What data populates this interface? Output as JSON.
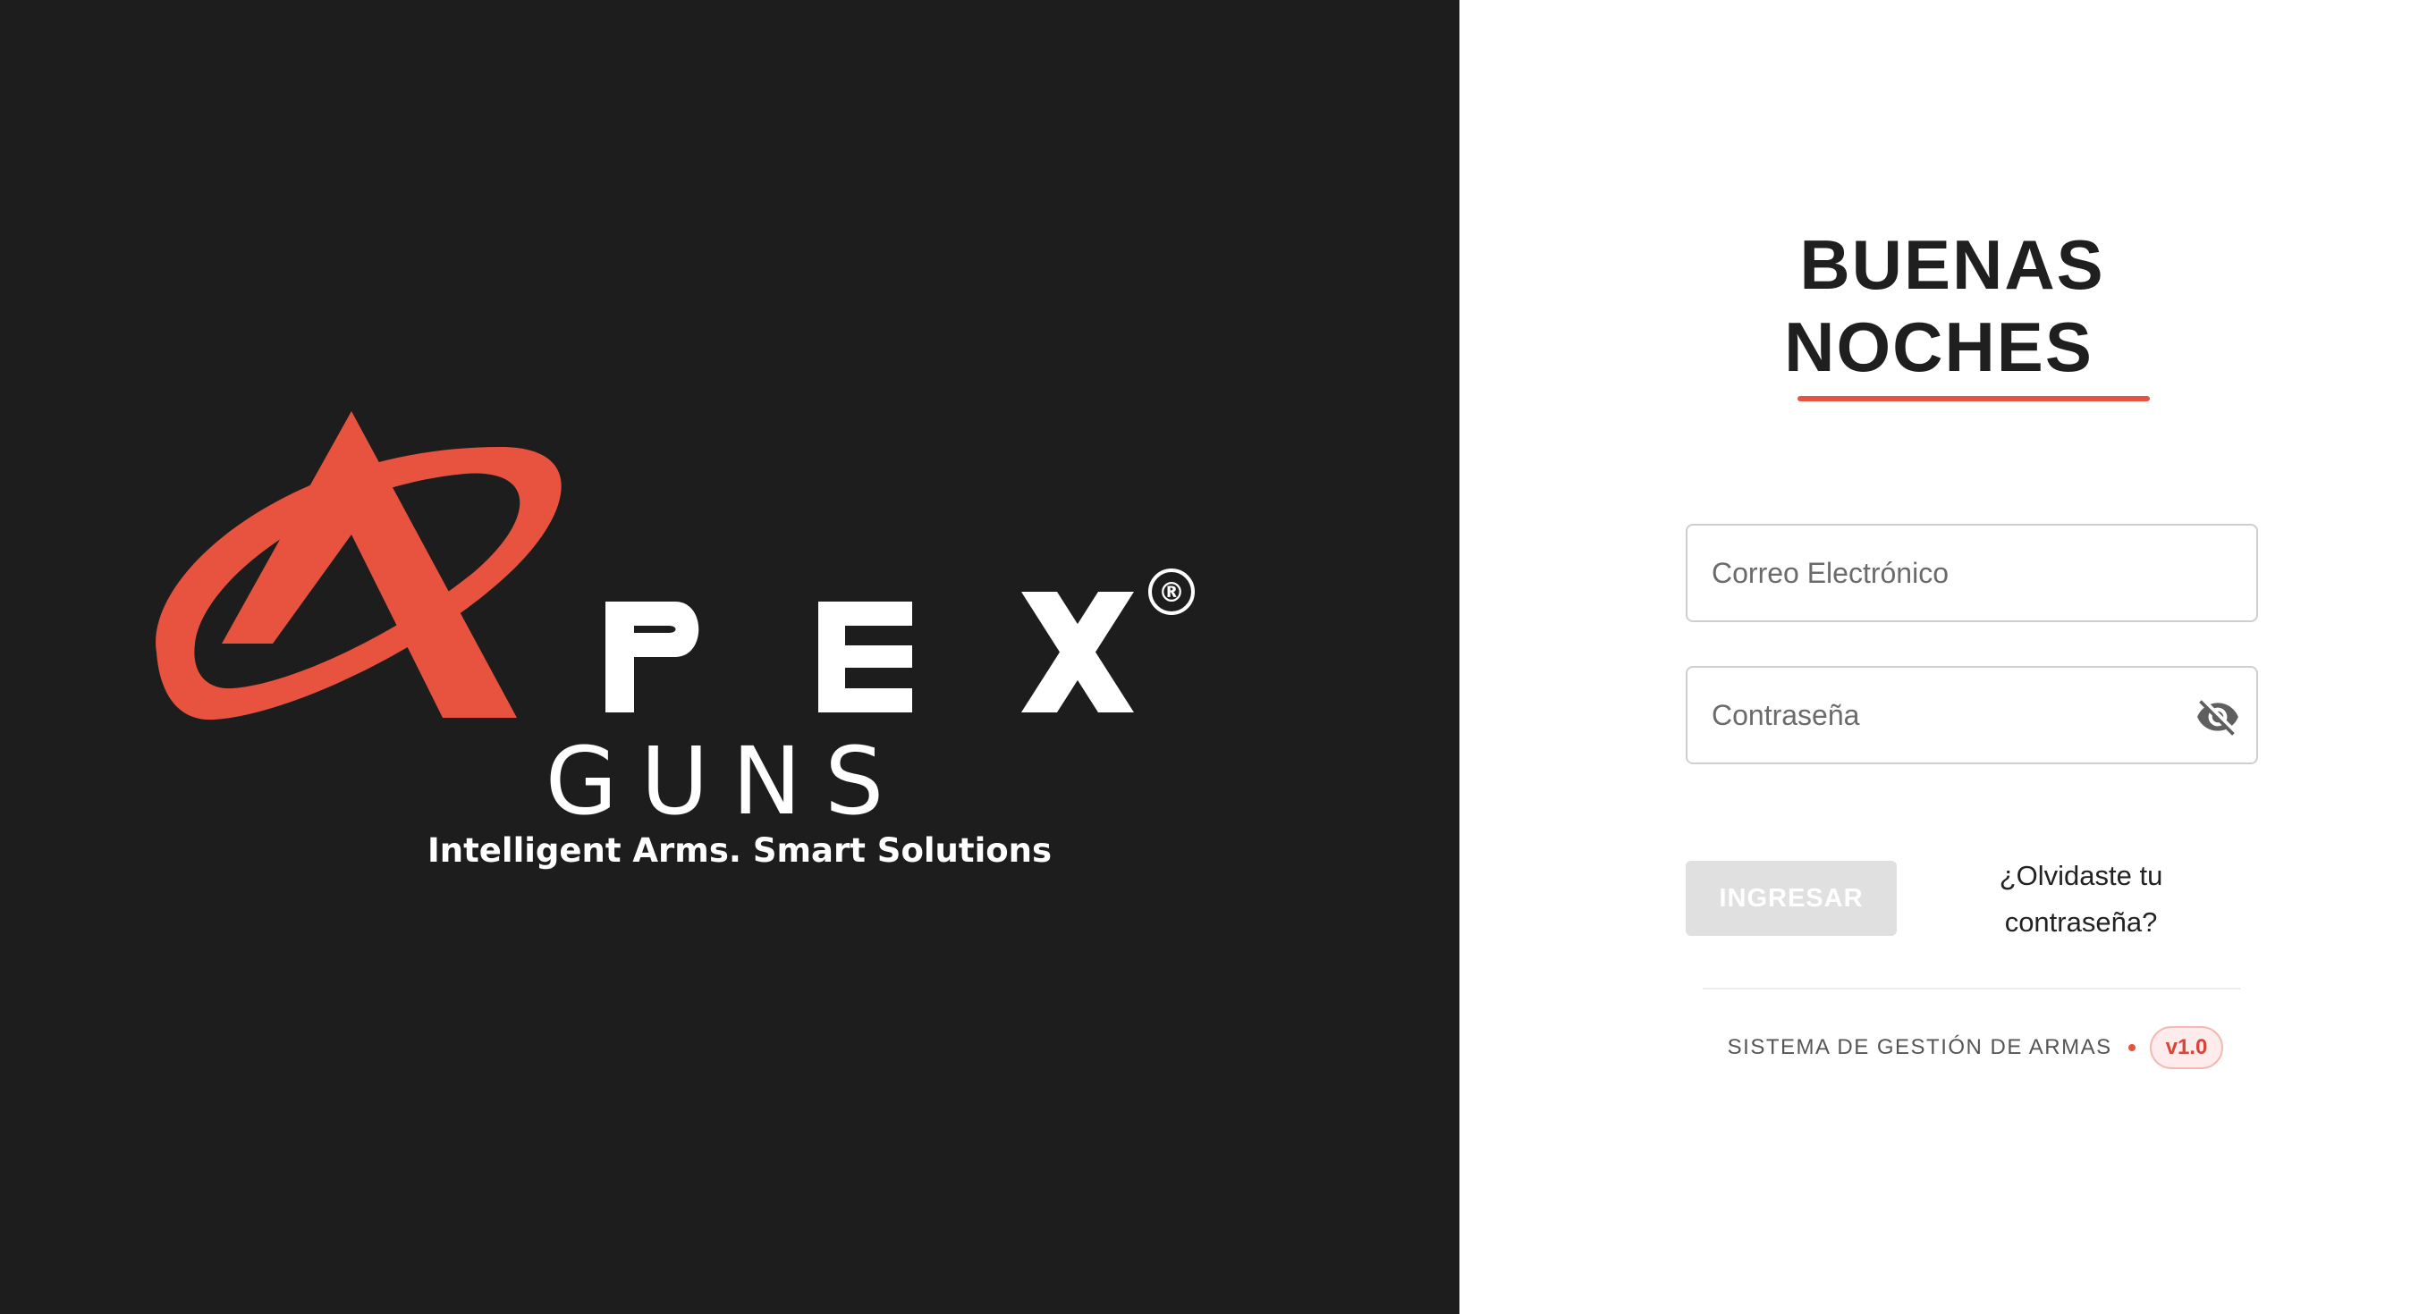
{
  "brand": {
    "logo_text": "PEX",
    "logo_subtext": "GUNS",
    "registered_mark": "®",
    "tagline": "Intelligent Arms. Smart Solutions",
    "accent_color": "#e8533f",
    "background_color": "#1d1d1d"
  },
  "login": {
    "greeting_line1": "BUENAS",
    "greeting_line2": "NOCHES",
    "email_placeholder": "Correo Electrónico",
    "password_placeholder": "Contraseña",
    "password_toggle_icon": "eye-off-icon",
    "submit_label": "INGRESAR",
    "forgot_line1": "¿Olvidaste tu",
    "forgot_line2": "contraseña?",
    "footer_text": "SISTEMA DE GESTIÓN DE ARMAS",
    "version": "v1.0"
  }
}
